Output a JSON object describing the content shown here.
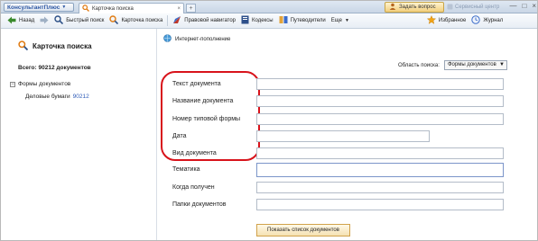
{
  "app": {
    "brand": "КонсультантПлюс"
  },
  "tab": {
    "label": "Карточка поиска",
    "close": "×"
  },
  "newtab": "+",
  "ask_button": "Задать вопрос",
  "service": "Сервисный центр",
  "window_controls": [
    "—",
    "□",
    "×"
  ],
  "toolbar": {
    "back": "Назад",
    "forward": "Вперед",
    "quick_search": "Быстрый поиск",
    "search_card": "Карточка поиска",
    "legal_navigator": "Правовой навигатор",
    "codexes": "Кодексы",
    "guides": "Путеводители",
    "more": "Еще",
    "favorites": "Избранное",
    "journal": "Журнал"
  },
  "left": {
    "title": "Карточка поиска",
    "total": "Всего: 90212 документов",
    "tree_toggle": "−",
    "tree_root": "Формы документов",
    "tree_child_label": "Деловые бумаги",
    "tree_child_count": "90212"
  },
  "main": {
    "subheader": "Интернет-пополнение",
    "area_label": "Область поиска:",
    "area_value": "Формы документов",
    "fields": [
      {
        "label": "Текст документа"
      },
      {
        "label": "Название документа"
      },
      {
        "label": "Номер типовой формы"
      },
      {
        "label": "Дата"
      },
      {
        "label": "Вид документа"
      },
      {
        "label": "Тематика"
      },
      {
        "label": "Когда получен"
      },
      {
        "label": "Папки документов"
      }
    ],
    "show_button": "Показать список документов"
  },
  "colors": {
    "highlight_oval": "#d8131b",
    "brand": "#2c56a3"
  }
}
